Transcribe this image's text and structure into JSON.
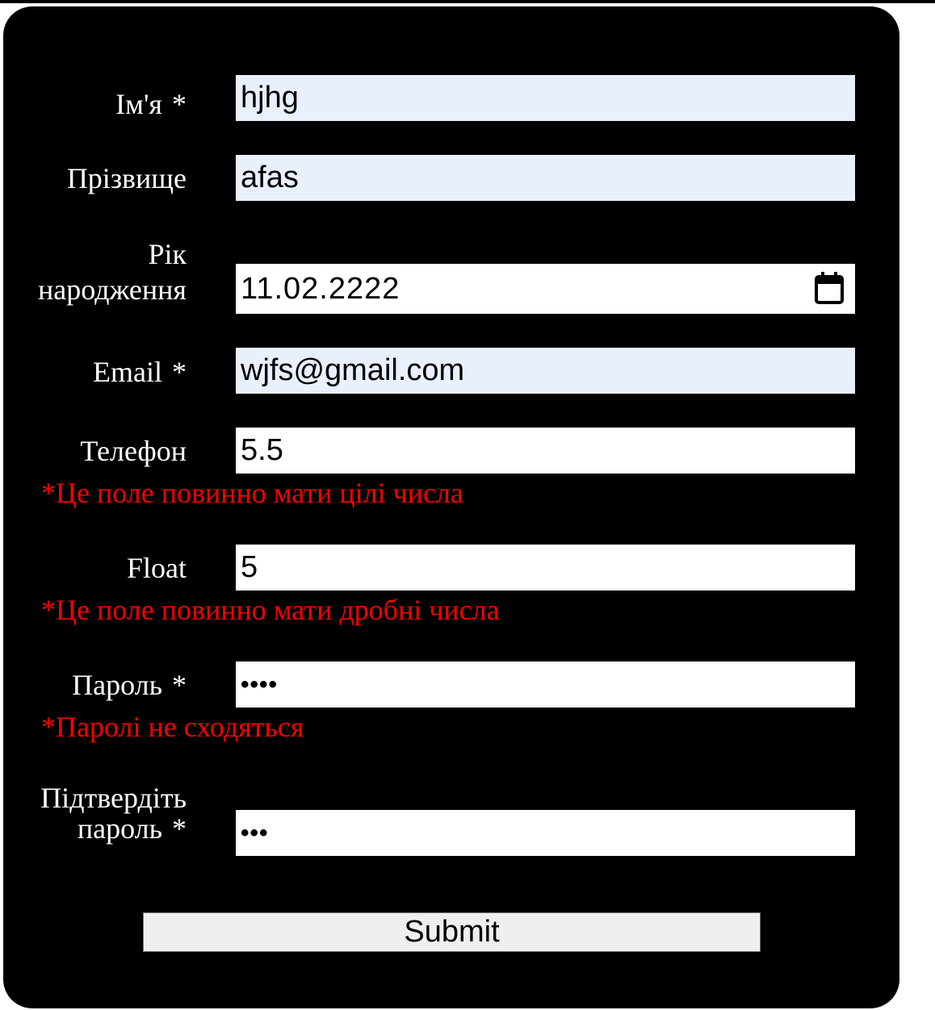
{
  "form": {
    "first_name": {
      "label": "Ім'я",
      "required_mark": "*",
      "value": "hjhg"
    },
    "last_name": {
      "label": "Прізвище",
      "value": "afas"
    },
    "birth_year": {
      "label_line1": "Рік",
      "label_line2": "народження",
      "value": "11.02.2222",
      "icon": "calendar-icon"
    },
    "email": {
      "label": "Email",
      "required_mark": "*",
      "value": "wjfs@gmail.com"
    },
    "phone": {
      "label": "Телефон",
      "value": "5.5",
      "error": "*Це поле повинно мати цілі числа"
    },
    "float": {
      "label": "Float",
      "value": "5",
      "error": "*Це поле повинно мати дробні числа"
    },
    "password": {
      "label": "Пароль",
      "required_mark": "*",
      "value_masked": "••••",
      "error": "*Паролі не сходяться"
    },
    "confirm_password": {
      "label_line1": "Підтвердіть",
      "label_line2": "пароль",
      "required_mark": "*",
      "value_masked": "•••"
    },
    "submit_label": "Submit"
  },
  "colors": {
    "background": "#000000",
    "label_text": "#ffffff",
    "error_text": "#ff0000",
    "autofill_bg": "#e8f0fe",
    "input_bg": "#ffffff",
    "button_bg": "#efefef"
  }
}
